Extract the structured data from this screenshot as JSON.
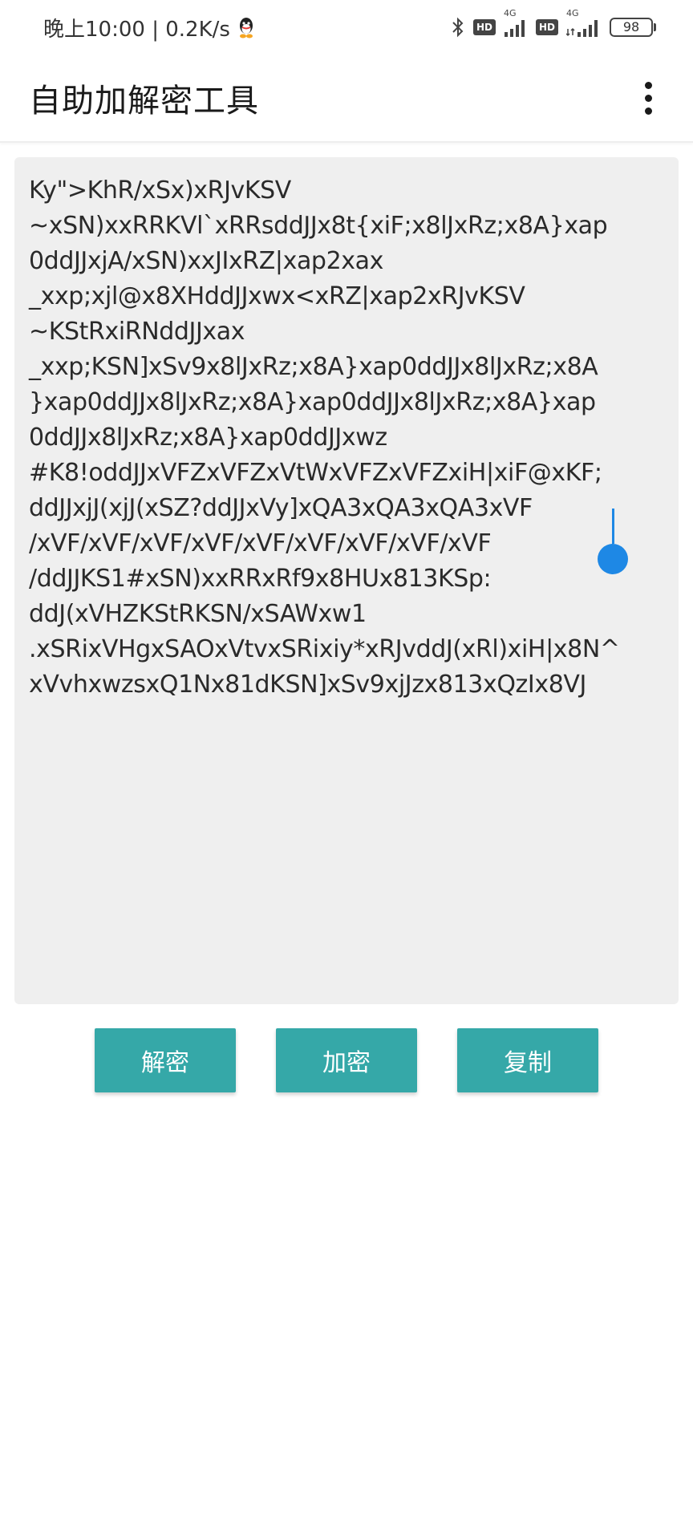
{
  "status_bar": {
    "time_speed": "晚上10:00 | 0.2K/s",
    "hd1": "HD",
    "net1": "4G",
    "hd2": "HD",
    "net2": "4G",
    "battery": "98",
    "icons": [
      "qq-icon",
      "bluetooth-icon",
      "signal-icon",
      "signal-icon",
      "battery-icon"
    ]
  },
  "app_bar": {
    "title": "自助加解密工具",
    "menu_icon": "more-vert-icon"
  },
  "editor": {
    "text": "Ky\">KhR/xSx)xRJvKSV\n~xSN)xxRRKVl`xRRsddJJx8t{xiF;x8lJxRz;x8A}xap\n0ddJJxjA/xSN)xxJIxRZ|xap2xax\n_xxp;xjl@x8XHddJJxwx<xRZ|xap2xRJvKSV\n~KStRxiRNddJJxax\n_xxp;KSN]xSv9x8lJxRz;x8A}xap0ddJJx8lJxRz;x8A\n}xap0ddJJx8lJxRz;x8A}xap0ddJJx8lJxRz;x8A}xap\n0ddJJx8lJxRz;x8A}xap0ddJJxwz\n#K8!oddJJxVFZxVFZxVtWxVFZxVFZxiH|xiF@xKF;\nddJJxjJ(xjJ(xSZ?ddJJxVy]xQA3xQA3xQA3xVF\n/xVF/xVF/xVF/xVF/xVF/xVF/xVF/xVF/xVF\n/ddJJKS1#xSN)xxRRxRf9x8HUx813KSp:\nddJ(xVHZKStRKSN/xSAWxw1\n.xSRixVHgxSAOxVtvxSRixiy*xRJvddJ(xRl)xiH|x8N^\nxVvhxwzsxQ1Nx81dKSN]xSv9xjJzx813xQzIx8VJ"
  },
  "buttons": {
    "decrypt": "解密",
    "encrypt": "加密",
    "copy": "复制"
  },
  "colors": {
    "accent": "#35a8a8",
    "caret": "#1e88e5",
    "editor_bg": "#efefef"
  }
}
